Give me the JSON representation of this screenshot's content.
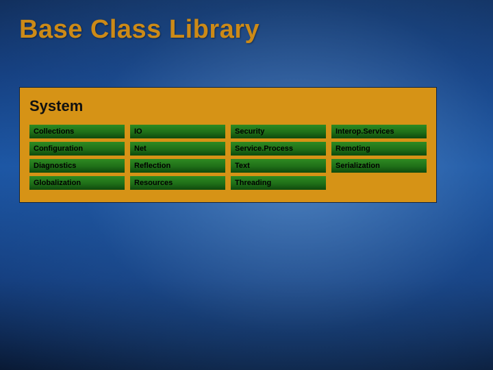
{
  "title": "Base Class Library",
  "panel": {
    "heading": "System",
    "cells": {
      "r0c0": "Collections",
      "r0c1": "IO",
      "r0c2": "Security",
      "r0c3": "Interop.Services",
      "r1c0": "Configuration",
      "r1c1": "Net",
      "r1c2": "Service.Process",
      "r1c3": "Remoting",
      "r2c0": "Diagnostics",
      "r2c1": "Reflection",
      "r2c2": "Text",
      "r2c3": "Serialization",
      "r3c0": "Globalization",
      "r3c1": "Resources",
      "r3c2": "Threading"
    }
  }
}
